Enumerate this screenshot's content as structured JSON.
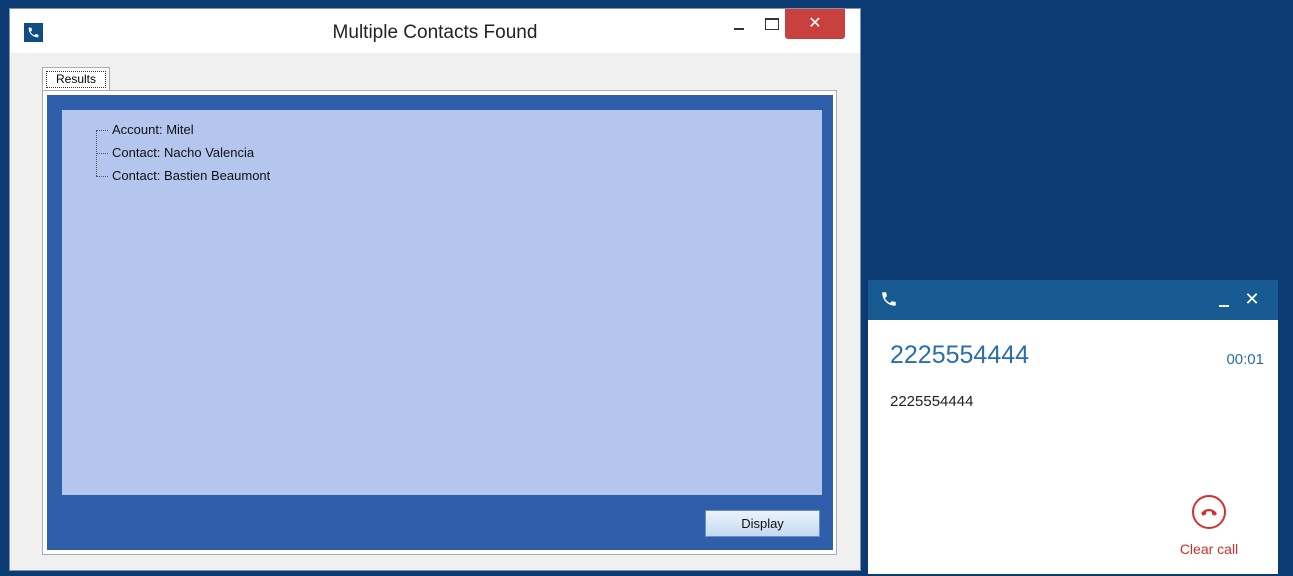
{
  "dialog": {
    "title": "Multiple Contacts Found",
    "close_glyph": "✕",
    "tab_label": "Results",
    "tree": [
      "Account: Mitel",
      "Contact: Nacho Valencia",
      "Contact: Bastien Beaumont"
    ],
    "display_button": "Display"
  },
  "call": {
    "number": "2225554444",
    "timer": "00:01",
    "caller_info": "2225554444",
    "close_glyph": "✕",
    "clear_call_label": "Clear call"
  },
  "colors": {
    "desktop": "#0c3a73",
    "panel_blue": "#2f5faa",
    "tree_bg": "#b4c6ee",
    "close_red": "#c9413f",
    "call_header": "#185b93",
    "accent_blue": "#2a6ea8",
    "hangup_red": "#d2302f"
  },
  "icons": {
    "app": "phone-icon",
    "hangup": "hangup-icon"
  }
}
